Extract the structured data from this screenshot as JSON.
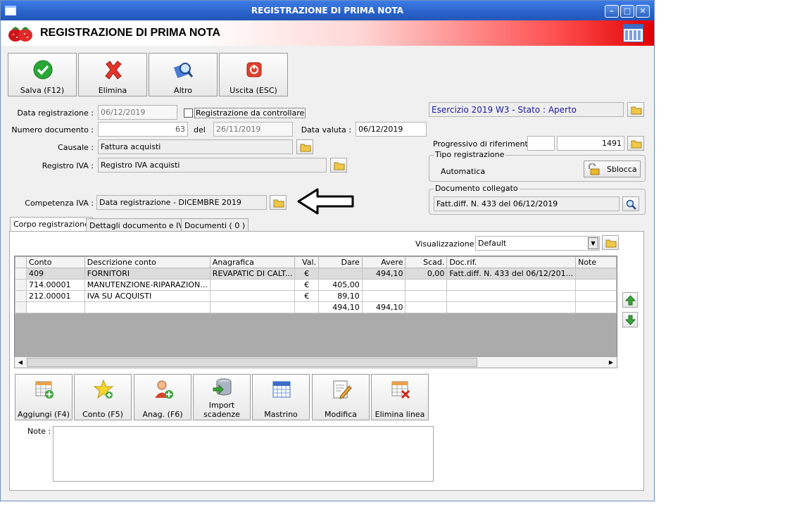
{
  "window": {
    "title": "REGISTRAZIONE DI PRIMA NOTA"
  },
  "header": {
    "title": "REGISTRAZIONE DI PRIMA NOTA"
  },
  "toolbar": [
    {
      "label": "Salva (F12)",
      "icon": "check-icon"
    },
    {
      "label": "Elimina",
      "icon": "delete-x-icon"
    },
    {
      "label": "Altro",
      "icon": "search-book-icon"
    },
    {
      "label": "Uscita (ESC)",
      "icon": "power-icon"
    }
  ],
  "form": {
    "data_registrazione_label": "Data registrazione :",
    "data_registrazione": "06/12/2019",
    "da_controllare_label": "Registrazione da controllare",
    "numero_documento_label": "Numero documento :",
    "numero_documento": "63",
    "del_label": "del",
    "del_value": "26/11/2019",
    "data_valuta_label": "Data valuta :",
    "data_valuta": "06/12/2019",
    "causale_label": "Causale :",
    "causale": "Fattura acquisti",
    "registro_iva_label": "Registro IVA :",
    "registro_iva": "Registro IVA acquisti",
    "competenza_iva_label": "Competenza IVA :",
    "competenza_iva": "Data registrazione - DICEMBRE 2019"
  },
  "right_panel": {
    "esercizio": "Esercizio 2019 W3 - Stato : Aperto",
    "progressivo_label": "Progressivo di riferimento :",
    "progressivo_value": "1491",
    "tipo_registrazione_title": "Tipo registrazione",
    "tipo_registrazione": "Automatica",
    "sblocca_label": "Sblocca",
    "documento_collegato_title": "Documento collegato",
    "documento_collegato": "Fatt.diff. N. 433 del 06/12/2019"
  },
  "tabs": [
    {
      "label": "Corpo registrazione"
    },
    {
      "label": "Dettagli documento e IVA"
    },
    {
      "label": "Documenti ( 0 )"
    }
  ],
  "visualizzazione": {
    "label": "Visualizzazione :",
    "value": "Default"
  },
  "table": {
    "columns": [
      "Conto",
      "Descrizione conto",
      "Anagrafica",
      "Val.",
      "Dare",
      "Avere",
      "Scad.",
      "Doc.rif.",
      "Note"
    ],
    "rows": [
      [
        "409",
        "FORNITORI",
        "REVAPATIC DI CALT...",
        "€",
        "",
        "494,10",
        "0,00",
        "Fatt.diff. N. 433 del 06/12/201...",
        ""
      ],
      [
        "714.00001",
        "MANUTENZIONE-RIPARAZION...",
        "",
        "€",
        "405,00",
        "",
        "",
        "",
        ""
      ],
      [
        "212.00001",
        "IVA SU ACQUISTI",
        "",
        "€",
        "89,10",
        "",
        "",
        "",
        ""
      ],
      [
        "",
        "",
        "",
        "",
        "494,10",
        "494,10",
        "",
        "",
        ""
      ]
    ]
  },
  "bottom_buttons": [
    {
      "label": "Aggiungi (F4)",
      "icon": "add-grid-icon"
    },
    {
      "label": "Conto (F5)",
      "icon": "star-add-icon"
    },
    {
      "label": "Anag. (F6)",
      "icon": "user-add-icon"
    },
    {
      "label": "Import scadenze",
      "icon": "database-import-icon"
    },
    {
      "label": "Mastrino",
      "icon": "calendar-grid-icon"
    },
    {
      "label": "Modifica",
      "icon": "edit-doc-icon"
    },
    {
      "label": "Elimina linea",
      "icon": "delete-grid-icon"
    }
  ],
  "note": {
    "label": "Note :"
  }
}
